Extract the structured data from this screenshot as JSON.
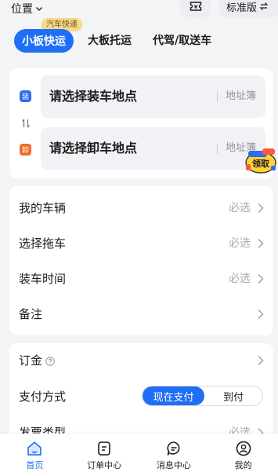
{
  "topbar": {
    "location_label": "位置",
    "ticket_icon": "ticket-icon",
    "mode_label": "标准版"
  },
  "tabs": {
    "badge": "汽车快递",
    "items": [
      {
        "label": "小板快运",
        "active": true
      },
      {
        "label": "大板托运",
        "active": false
      },
      {
        "label": "代驾/取送车",
        "active": false
      }
    ]
  },
  "address": {
    "load": {
      "tag": "装",
      "placeholder": "请选择装车地点",
      "book": "地址簿"
    },
    "unload": {
      "tag": "卸",
      "placeholder": "请选择卸车地点",
      "book": "地址簿"
    },
    "claim_label": "领取"
  },
  "form": {
    "rows": [
      {
        "label": "我的车辆",
        "value": "必选"
      },
      {
        "label": "选择拖车",
        "value": "必选"
      },
      {
        "label": "装车时间",
        "value": "必选"
      },
      {
        "label": "备注",
        "value": ""
      }
    ]
  },
  "payment": {
    "deposit_label": "订金",
    "method_label": "支付方式",
    "method_options": [
      "现在支付",
      "到付"
    ],
    "method_selected": "现在支付",
    "invoice_label": "发票类型",
    "invoice_value": "必选"
  },
  "nav": {
    "items": [
      {
        "label": "首页",
        "icon": "home-icon",
        "active": true
      },
      {
        "label": "订单中心",
        "icon": "order-icon",
        "active": false
      },
      {
        "label": "消息中心",
        "icon": "message-icon",
        "active": false
      },
      {
        "label": "我的",
        "icon": "profile-icon",
        "active": false
      }
    ]
  },
  "colors": {
    "accent": "#1f6ef6",
    "load_tag": "#2e6cf0",
    "unload_tag": "#f16b2a",
    "badge_bg": "#f6d98a"
  }
}
